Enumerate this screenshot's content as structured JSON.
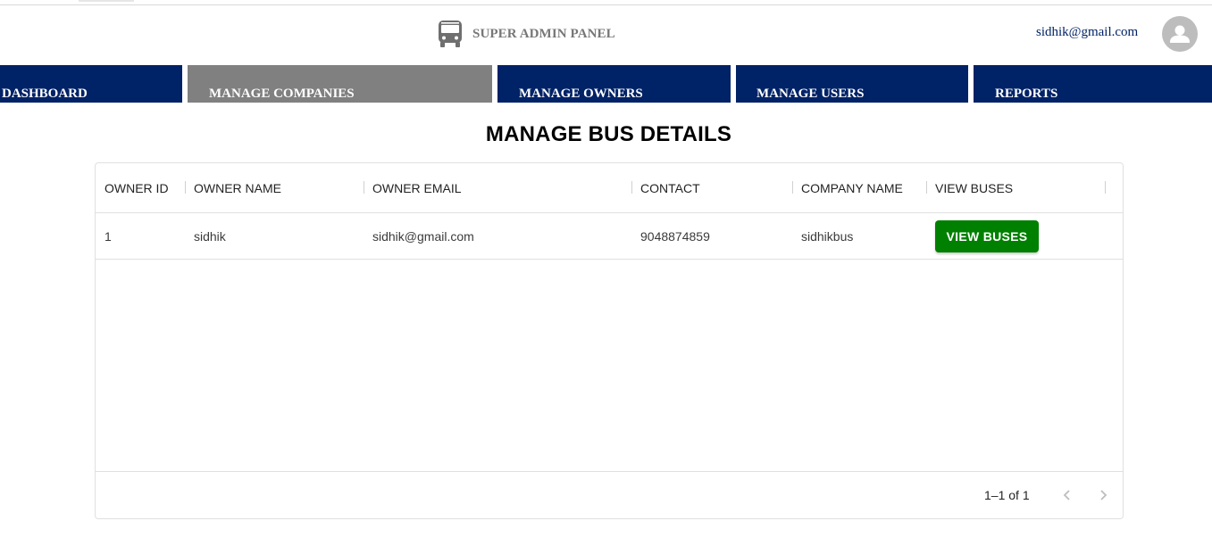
{
  "header": {
    "title": "SUPER ADMIN PANEL",
    "brand_icon": "bus-icon",
    "user_email": "sidhik@gmail.com",
    "avatar_icon": "person-icon"
  },
  "nav": {
    "items": [
      {
        "label": "DASHBOARD"
      },
      {
        "label": "MANAGE COMPANIES"
      },
      {
        "label": "MANAGE OWNERS"
      },
      {
        "label": "MANAGE USERS"
      },
      {
        "label": "REPORTS"
      }
    ],
    "active": "MANAGE COMPANIES"
  },
  "page": {
    "title": "MANAGE BUS DETAILS"
  },
  "table": {
    "columns": [
      "OWNER ID",
      "OWNER NAME",
      "OWNER EMAIL",
      "CONTACT",
      "COMPANY NAME",
      "VIEW BUSES"
    ],
    "rows": [
      {
        "owner_id": "1",
        "owner_name": "sidhik",
        "owner_email": "sidhik@gmail.com",
        "contact": "9048874859",
        "company_name": "sidhikbus",
        "action_label": "VIEW BUSES"
      }
    ],
    "pagination": {
      "info": "1–1 of 1",
      "prev_icon": "chevron-left-icon",
      "next_icon": "chevron-right-icon"
    }
  },
  "colors": {
    "nav_bg": "#002266",
    "nav_active_bg": "#808080",
    "button_green": "#008000",
    "email_blue": "#002266"
  }
}
